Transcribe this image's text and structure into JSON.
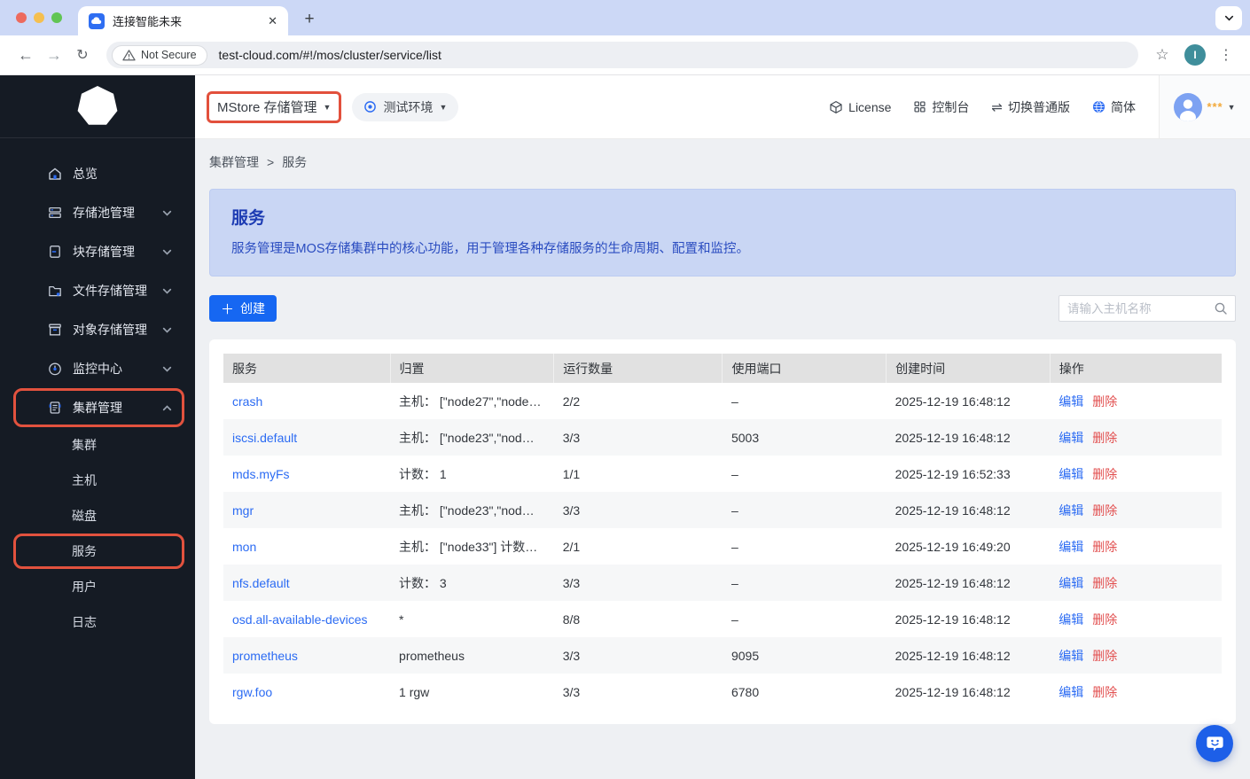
{
  "browser": {
    "tab_title": "连接智能未来",
    "security_label": "Not Secure",
    "url": "test-cloud.com/#!/mos/cluster/service/list",
    "profile_initial": "I"
  },
  "app_header": {
    "product_label": "MStore 存储管理",
    "environment_label": "测试环境",
    "actions": [
      {
        "id": "license",
        "label": "License",
        "icon": "license-icon"
      },
      {
        "id": "console",
        "label": "控制台",
        "icon": "console-icon"
      },
      {
        "id": "switch-normal",
        "label": "切换普通版",
        "icon": "switch-icon"
      },
      {
        "id": "language-simplified",
        "label": "简体",
        "icon": "globe-icon"
      }
    ],
    "user_mask": "***"
  },
  "sidebar": {
    "items": [
      {
        "id": "overview",
        "label": "总览",
        "icon": "home"
      },
      {
        "id": "storage-pool",
        "label": "存储池管理",
        "icon": "pool",
        "expandable": true
      },
      {
        "id": "block-storage",
        "label": "块存储管理",
        "icon": "block",
        "expandable": true
      },
      {
        "id": "file-storage",
        "label": "文件存储管理",
        "icon": "file",
        "expandable": true
      },
      {
        "id": "object-storage",
        "label": "对象存储管理",
        "icon": "object",
        "expandable": true
      },
      {
        "id": "monitor-center",
        "label": "监控中心",
        "icon": "monitor",
        "expandable": true
      },
      {
        "id": "cluster-management",
        "label": "集群管理",
        "icon": "cluster",
        "expandable": true,
        "expanded": true,
        "annotated": true,
        "children": [
          {
            "id": "cluster",
            "label": "集群"
          },
          {
            "id": "hosts",
            "label": "主机"
          },
          {
            "id": "disks",
            "label": "磁盘"
          },
          {
            "id": "services",
            "label": "服务",
            "annotated": true
          },
          {
            "id": "users",
            "label": "用户"
          },
          {
            "id": "logs",
            "label": "日志"
          }
        ]
      }
    ]
  },
  "breadcrumb": {
    "section": "集群管理",
    "separator": ">",
    "page": "服务"
  },
  "banner": {
    "title": "服务",
    "description": "服务管理是MOS存储集群中的核心功能，用于管理各种存储服务的生命周期、配置和监控。"
  },
  "toolbar": {
    "create_label": "创建",
    "search_placeholder": "请输入主机名称"
  },
  "table": {
    "columns": [
      "服务",
      "归置",
      "运行数量",
      "使用端口",
      "创建时间",
      "操作"
    ],
    "actions": {
      "edit": "编辑",
      "delete": "删除"
    },
    "rows": [
      {
        "service": "crash",
        "placement": "主机： [\"node27\",\"node…",
        "running": "2/2",
        "port": "–",
        "created": "2025-12-19 16:48:12"
      },
      {
        "service": "iscsi.default",
        "placement": "主机： [\"node23\",\"nod…",
        "running": "3/3",
        "port": "5003",
        "created": "2025-12-19 16:48:12"
      },
      {
        "service": "mds.myFs",
        "placement": "计数： 1",
        "running": "1/1",
        "port": "–",
        "created": "2025-12-19 16:52:33"
      },
      {
        "service": "mgr",
        "placement": "主机： [\"node23\",\"nod…",
        "running": "3/3",
        "port": "–",
        "created": "2025-12-19 16:48:12"
      },
      {
        "service": "mon",
        "placement": "主机： [\"node33\"] 计数…",
        "running": "2/1",
        "port": "–",
        "created": "2025-12-19 16:49:20"
      },
      {
        "service": "nfs.default",
        "placement": "计数： 3",
        "running": "3/3",
        "port": "–",
        "created": "2025-12-19 16:48:12"
      },
      {
        "service": "osd.all-available-devices",
        "placement": "*",
        "running": "8/8",
        "port": "–",
        "created": "2025-12-19 16:48:12"
      },
      {
        "service": "prometheus",
        "placement": "prometheus",
        "running": "3/3",
        "port": "9095",
        "created": "2025-12-19 16:48:12"
      },
      {
        "service": "rgw.foo",
        "placement": "1 rgw",
        "running": "3/3",
        "port": "6780",
        "created": "2025-12-19 16:48:12"
      }
    ]
  },
  "colors": {
    "annotation_red": "#e2523e",
    "accent_blue": "#1667f2",
    "link_blue": "#2b6bf3",
    "delete_red": "#e25050",
    "banner_bg": "#c9d6f4",
    "sidebar_bg": "#151b24",
    "tabstrip_bg": "#ccd8f6"
  }
}
